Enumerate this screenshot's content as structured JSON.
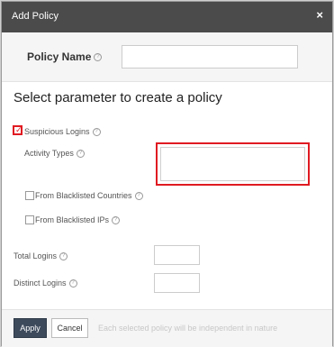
{
  "dialog": {
    "title": "Add Policy",
    "close_glyph": "×"
  },
  "policy_name": {
    "label": "Policy Name",
    "value": "",
    "help_glyph": "?"
  },
  "section": {
    "title": "Select parameter to create a policy"
  },
  "suspicious_logins": {
    "label": "Suspicious Logins",
    "checked": true,
    "check_glyph": "✓"
  },
  "activity_types": {
    "label": "Activity Types",
    "value": ""
  },
  "options": {
    "blacklisted_countries": "From Blacklisted Countries",
    "blacklisted_ips": "From Blacklisted IPs"
  },
  "total_logins": {
    "label": "Total Logins",
    "value": ""
  },
  "distinct_logins": {
    "label": "Distinct Logins",
    "value": ""
  },
  "footer": {
    "apply_label": "Apply",
    "cancel_label": "Cancel",
    "note": "Each selected policy will be independent in nature"
  },
  "colors": {
    "titlebar": "#4b4b4b",
    "highlight": "#e01b22",
    "apply_button": "#3d4a5c"
  }
}
